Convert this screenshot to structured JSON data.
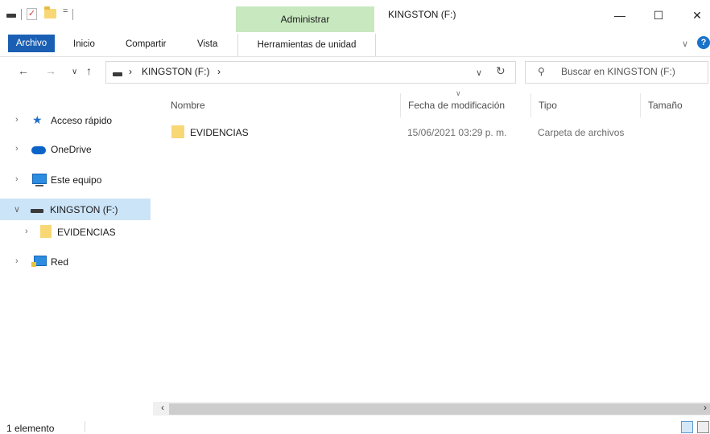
{
  "titlebar": {
    "contextual_group": "Administrar",
    "title": "KINGSTON (F:)",
    "quick_access_pin": "=",
    "minimize_icon": "—",
    "maximize_icon": "☐",
    "close_icon": "✕"
  },
  "ribbon": {
    "tabs": [
      "Archivo",
      "Inicio",
      "Compartir",
      "Vista",
      "Herramientas de unidad"
    ],
    "collapse_icon": "∨",
    "help_icon": "?"
  },
  "address": {
    "back_icon": "←",
    "forward_icon": "→",
    "recent_icon": "∨",
    "up_icon": "↑",
    "separator": "›",
    "location": "KINGSTON (F:)",
    "trailing_separator": "›",
    "dropdown_icon": "∨",
    "refresh_icon": "↻"
  },
  "search": {
    "icon": "⚲",
    "placeholder": "Buscar en KINGSTON (F:)"
  },
  "nav": {
    "items": [
      {
        "label": "Acceso rápido",
        "chevron": "›",
        "icon": "quick-access-star-icon"
      },
      {
        "label": "OneDrive",
        "chevron": "›",
        "icon": "onedrive-cloud-icon"
      },
      {
        "label": "Este equipo",
        "chevron": "›",
        "icon": "this-pc-icon"
      },
      {
        "label": "KINGSTON (F:)",
        "chevron": "∨",
        "icon": "usb-drive-icon",
        "selected": true
      },
      {
        "label": "EVIDENCIAS",
        "chevron": "›",
        "icon": "folder-icon"
      },
      {
        "label": "Red",
        "chevron": "›",
        "icon": "network-icon"
      }
    ],
    "star_glyph": "★"
  },
  "content": {
    "columns": [
      "Nombre",
      "Fecha de modificación",
      "Tipo",
      "Tamaño"
    ],
    "sort_indicator": "∨",
    "rows": [
      {
        "name": "EVIDENCIAS",
        "modified": "15/06/2021 03:29 p. m.",
        "type": "Carpeta de archivos",
        "size": ""
      }
    ]
  },
  "scrollbar": {
    "left_arrow": "‹",
    "right_arrow": "›"
  },
  "status": {
    "item_count": "1 elemento"
  },
  "colors": {
    "selection": "#cce4f7",
    "file_tab": "#1a5fb4",
    "context_group": "#c8e8c0",
    "folder": "#f8d775"
  }
}
